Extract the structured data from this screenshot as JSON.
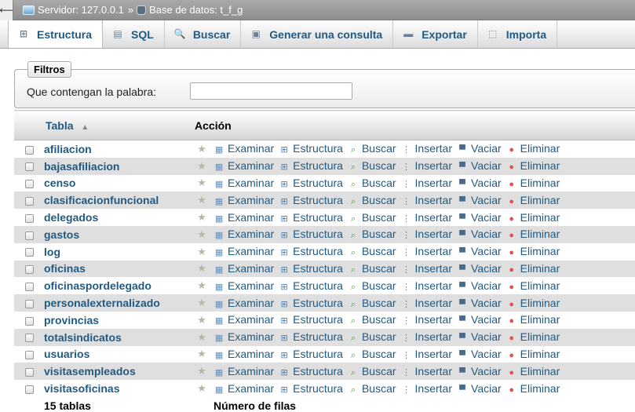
{
  "breadcrumb": {
    "server_label": "Servidor: 127.0.0.1",
    "separator": "»",
    "db_label": "Base de datos: t_f_g"
  },
  "icons": {
    "back": "back-arrow-icon",
    "server": "server-icon",
    "database": "database-icon"
  },
  "tabs": [
    {
      "label": "Estructura",
      "icon": "structure-icon",
      "glyph": "⊞",
      "active": true
    },
    {
      "label": "SQL",
      "icon": "sql-icon",
      "glyph": "▤",
      "active": false
    },
    {
      "label": "Buscar",
      "icon": "search-icon",
      "glyph": "🔍",
      "active": false
    },
    {
      "label": "Generar una consulta",
      "icon": "query-icon",
      "glyph": "▣",
      "active": false
    },
    {
      "label": "Exportar",
      "icon": "export-icon",
      "glyph": "▬",
      "active": false
    },
    {
      "label": "Importa",
      "icon": "import-icon",
      "glyph": "⬚",
      "active": false
    }
  ],
  "filters": {
    "legend": "Filtros",
    "label": "Que contengan la palabra:",
    "value": ""
  },
  "table": {
    "col_name": "Tabla",
    "col_action": "Acción",
    "actions": [
      {
        "label": "Examinar",
        "icon": "browse-icon",
        "glyph": "▦",
        "cls": "ic-browse"
      },
      {
        "label": "Estructura",
        "icon": "structure-icon",
        "glyph": "⊞",
        "cls": "ic-struct"
      },
      {
        "label": "Buscar",
        "icon": "search-icon",
        "glyph": "⌕",
        "cls": "ic-search"
      },
      {
        "label": "Insertar",
        "icon": "insert-icon",
        "glyph": "⋮",
        "cls": "ic-insert"
      },
      {
        "label": "Vaciar",
        "icon": "empty-icon",
        "glyph": "▀",
        "cls": "ic-empty"
      },
      {
        "label": "Eliminar",
        "icon": "drop-icon",
        "glyph": "●",
        "cls": "ic-drop"
      }
    ],
    "rows": [
      "afiliacion",
      "bajasafiliacion",
      "censo",
      "clasificacionfuncional",
      "delegados",
      "gastos",
      "log",
      "oficinas",
      "oficinaspordelegado",
      "personalexternalizado",
      "provincias",
      "totalsindicatos",
      "usuarios",
      "visitasempleados",
      "visitasoficinas"
    ],
    "footer_count": "15 tablas",
    "footer_label": "Número de filas"
  },
  "colors": {
    "link": "#235a81",
    "row_alt": "#dfdfdf",
    "topbar": "#999999"
  }
}
